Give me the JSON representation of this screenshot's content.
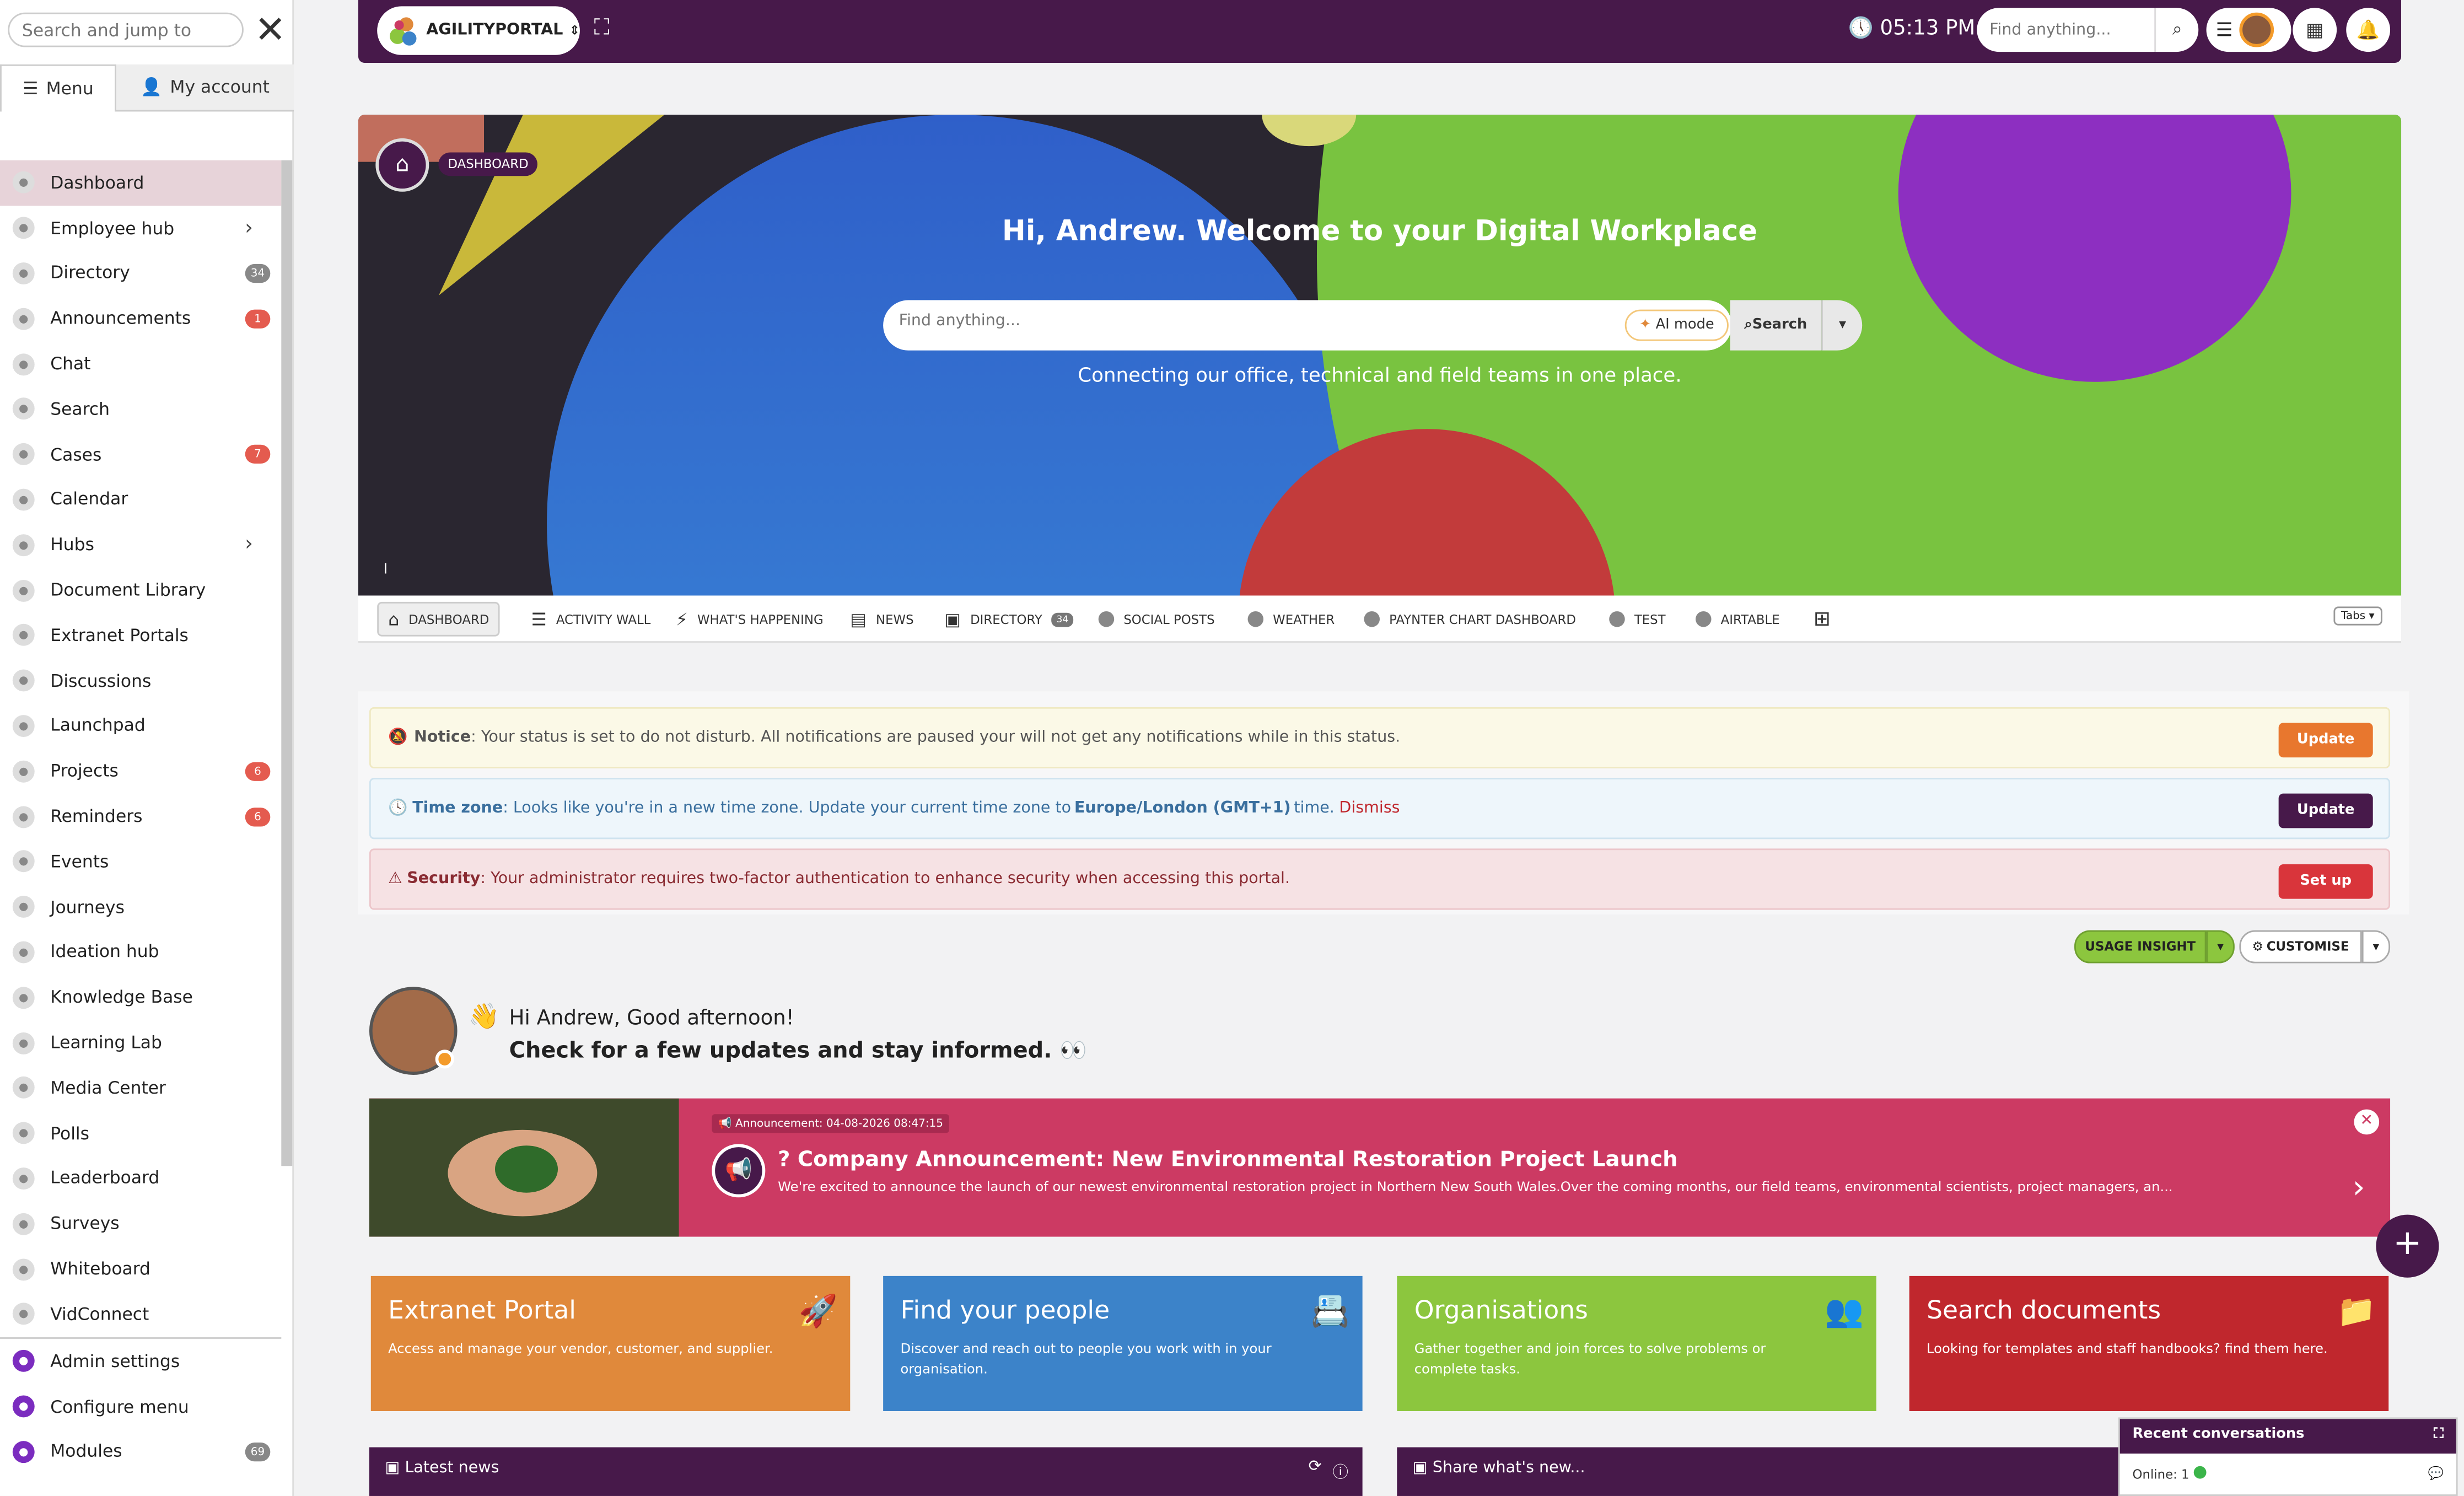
{
  "sidebar": {
    "search_placeholder": "Search and jump to",
    "tab_menu": "Menu",
    "tab_account": "My account",
    "items": [
      {
        "label": "Dashboard",
        "badge": ""
      },
      {
        "label": "Employee hub",
        "badge": ""
      },
      {
        "label": "Directory",
        "badge": "34"
      },
      {
        "label": "Announcements",
        "badge": "1"
      },
      {
        "label": "Chat",
        "badge": ""
      },
      {
        "label": "Search",
        "badge": ""
      },
      {
        "label": "Cases",
        "badge": "7"
      },
      {
        "label": "Calendar",
        "badge": ""
      },
      {
        "label": "Hubs",
        "badge": ""
      },
      {
        "label": "Document Library",
        "badge": ""
      },
      {
        "label": "Extranet Portals",
        "badge": ""
      },
      {
        "label": "Discussions",
        "badge": ""
      },
      {
        "label": "Launchpad",
        "badge": ""
      },
      {
        "label": "Projects",
        "badge": "6"
      },
      {
        "label": "Reminders",
        "badge": "6"
      },
      {
        "label": "Events",
        "badge": ""
      },
      {
        "label": "Journeys",
        "badge": ""
      },
      {
        "label": "Ideation hub",
        "badge": ""
      },
      {
        "label": "Knowledge Base",
        "badge": ""
      },
      {
        "label": "Learning Lab",
        "badge": ""
      },
      {
        "label": "Media Center",
        "badge": ""
      },
      {
        "label": "Polls",
        "badge": ""
      },
      {
        "label": "Leaderboard",
        "badge": ""
      },
      {
        "label": "Surveys",
        "badge": ""
      },
      {
        "label": "Whiteboard",
        "badge": ""
      },
      {
        "label": "VidConnect",
        "badge": ""
      }
    ],
    "bottom": [
      {
        "label": "Admin settings",
        "badge": ""
      },
      {
        "label": "Configure menu",
        "badge": ""
      },
      {
        "label": "Modules",
        "badge": "69"
      }
    ]
  },
  "topbar": {
    "brand": "AGILITYPORTAL",
    "time": "05:13 PM",
    "search_placeholder": "Find anything..."
  },
  "hero": {
    "crumb": "DASHBOARD",
    "title": "Hi, Andrew. Welcome to your Digital Workplace",
    "search_placeholder": "Find anything...",
    "ai_mode": "AI mode",
    "search_btn": "Search",
    "subtitle": "Connecting our office, technical and field teams in one place.",
    "marker": "I"
  },
  "tabs": [
    {
      "label": "DASHBOARD",
      "count": ""
    },
    {
      "label": "ACTIVITY WALL",
      "count": ""
    },
    {
      "label": "WHAT'S HAPPENING",
      "count": ""
    },
    {
      "label": "NEWS",
      "count": ""
    },
    {
      "label": "DIRECTORY",
      "count": "34"
    },
    {
      "label": "SOCIAL POSTS",
      "count": ""
    },
    {
      "label": "WEATHER",
      "count": ""
    },
    {
      "label": "PAYNTER CHART DASHBOARD",
      "count": ""
    },
    {
      "label": "TEST",
      "count": ""
    },
    {
      "label": "AIRTABLE",
      "count": ""
    }
  ],
  "tabs_selector": "Tabs",
  "alerts": {
    "notice_label": "Notice",
    "notice_text": ": Your status is set to do not disturb. All notifications are paused your will not get any notifications while in this status.",
    "notice_btn": "Update",
    "tz_label": "Time zone",
    "tz_text": ": Looks like you're in a new time zone. Update your current time zone to ",
    "tz_zone": "Europe/London (GMT+1)",
    "tz_after": " time. ",
    "tz_dismiss": "Dismiss",
    "tz_btn": "Update",
    "sec_label": "Security",
    "sec_text": ": Your administrator requires two-factor authentication to enhance security when accessing this portal.",
    "sec_btn": "Set up"
  },
  "actions": {
    "usage": "USAGE INSIGHT",
    "customise": "CUSTOMISE"
  },
  "greeting": {
    "line1": "Hi Andrew, Good afternoon!",
    "line2": "Check for a few updates and stay informed. 👀"
  },
  "announcement": {
    "date": "Announcement: 04-08-2026 08:47:15",
    "title": "? Company Announcement: New Environmental Restoration Project Launch",
    "text": "We're excited to announce the launch of our newest environmental restoration project in Northern New South Wales.Over the coming months, our field teams, environmental scientists, project managers, an..."
  },
  "cards": [
    {
      "title": "Extranet Portal",
      "text": "Access and manage your vendor, customer, and supplier.",
      "color": "#e0893b"
    },
    {
      "title": "Find your people",
      "text": "Discover and reach out to people you work with in your organisation.",
      "color": "#3c83c9"
    },
    {
      "title": "Organisations",
      "text": "Gather together and join forces to solve problems or complete tasks.",
      "color": "#8cc63e"
    },
    {
      "title": "Search documents",
      "text": "Looking for templates and staff handbooks? find them here.",
      "color": "#c0272d"
    }
  ],
  "panels": {
    "news": "Latest news",
    "share": "Share what's new..."
  },
  "recent": {
    "title": "Recent conversations",
    "online": "Online: 1"
  },
  "colors": {
    "brand": "#47194a",
    "accent": "#cc3a63"
  }
}
